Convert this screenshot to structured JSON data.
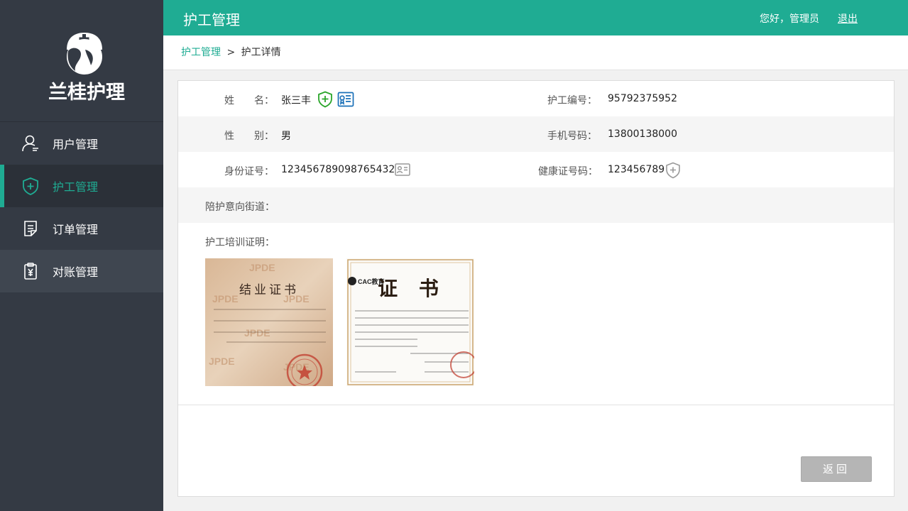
{
  "app": {
    "logo_text": "兰桂护理"
  },
  "sidebar": {
    "items": [
      {
        "label": "用户管理",
        "icon": "user-icon"
      },
      {
        "label": "护工管理",
        "icon": "shield-cross-icon",
        "active": true
      },
      {
        "label": "订单管理",
        "icon": "document-icon"
      },
      {
        "label": "对账管理",
        "icon": "clipboard-yen-icon"
      }
    ]
  },
  "header": {
    "title": "护工管理",
    "greeting": "您好，管理员",
    "logout": "退出"
  },
  "breadcrumb": {
    "parent": "护工管理",
    "separator": ">",
    "current": "护工详情"
  },
  "detail": {
    "name_label": "姓　　名：",
    "name_value": "张三丰",
    "worker_no_label": "护工编号：",
    "worker_no_value": "95792375952",
    "gender_label": "性　　别：",
    "gender_value": "男",
    "phone_label": "手机号码：",
    "phone_value": "13800138000",
    "id_label": "身份证号：",
    "id_value": "123456789098765432",
    "health_label": "健康证号码：",
    "health_value": "123456789",
    "street_label": "陪护意向街道：",
    "street_value": "",
    "training_label": "护工培训证明："
  },
  "certificates": [
    {
      "title": "结业证书",
      "watermark": "JPDE"
    },
    {
      "title": "证 书",
      "org": "CAC教育"
    }
  ],
  "actions": {
    "back_label": "返回"
  },
  "colors": {
    "accent": "#1fac93",
    "sidebar": "#343a44"
  }
}
